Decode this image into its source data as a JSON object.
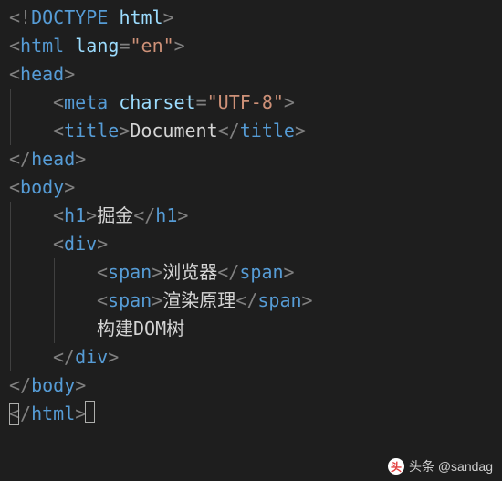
{
  "code": {
    "lines": [
      {
        "indent": 0,
        "guides": [],
        "tokens": [
          {
            "t": "punct",
            "v": "<!"
          },
          {
            "t": "tag",
            "v": "DOCTYPE"
          },
          {
            "t": "text",
            "v": " "
          },
          {
            "t": "attr-name",
            "v": "html"
          },
          {
            "t": "punct",
            "v": ">"
          }
        ]
      },
      {
        "indent": 0,
        "guides": [],
        "tokens": [
          {
            "t": "punct",
            "v": "<"
          },
          {
            "t": "tag",
            "v": "html"
          },
          {
            "t": "text",
            "v": " "
          },
          {
            "t": "attr-name",
            "v": "lang"
          },
          {
            "t": "punct",
            "v": "="
          },
          {
            "t": "attr-value",
            "v": "\"en\""
          },
          {
            "t": "punct",
            "v": ">"
          }
        ]
      },
      {
        "indent": 0,
        "guides": [],
        "tokens": [
          {
            "t": "punct",
            "v": "<"
          },
          {
            "t": "tag",
            "v": "head"
          },
          {
            "t": "punct",
            "v": ">"
          }
        ]
      },
      {
        "indent": 1,
        "guides": [
          0
        ],
        "tokens": [
          {
            "t": "punct",
            "v": "<"
          },
          {
            "t": "tag",
            "v": "meta"
          },
          {
            "t": "text",
            "v": " "
          },
          {
            "t": "attr-name",
            "v": "charset"
          },
          {
            "t": "punct",
            "v": "="
          },
          {
            "t": "attr-value",
            "v": "\"UTF-8\""
          },
          {
            "t": "punct",
            "v": ">"
          }
        ]
      },
      {
        "indent": 1,
        "guides": [
          0
        ],
        "tokens": [
          {
            "t": "punct",
            "v": "<"
          },
          {
            "t": "tag",
            "v": "title"
          },
          {
            "t": "punct",
            "v": ">"
          },
          {
            "t": "text",
            "v": "Document"
          },
          {
            "t": "punct",
            "v": "</"
          },
          {
            "t": "tag",
            "v": "title"
          },
          {
            "t": "punct",
            "v": ">"
          }
        ]
      },
      {
        "indent": 0,
        "guides": [],
        "tokens": [
          {
            "t": "punct",
            "v": "</"
          },
          {
            "t": "tag",
            "v": "head"
          },
          {
            "t": "punct",
            "v": ">"
          }
        ]
      },
      {
        "indent": 0,
        "guides": [],
        "tokens": [
          {
            "t": "punct",
            "v": "<"
          },
          {
            "t": "tag",
            "v": "body"
          },
          {
            "t": "punct",
            "v": ">"
          }
        ]
      },
      {
        "indent": 1,
        "guides": [
          0
        ],
        "tokens": [
          {
            "t": "punct",
            "v": "<"
          },
          {
            "t": "tag",
            "v": "h1"
          },
          {
            "t": "punct",
            "v": ">"
          },
          {
            "t": "text",
            "v": "掘金"
          },
          {
            "t": "punct",
            "v": "</"
          },
          {
            "t": "tag",
            "v": "h1"
          },
          {
            "t": "punct",
            "v": ">"
          }
        ]
      },
      {
        "indent": 1,
        "guides": [
          0
        ],
        "tokens": [
          {
            "t": "punct",
            "v": "<"
          },
          {
            "t": "tag",
            "v": "div"
          },
          {
            "t": "punct",
            "v": ">"
          }
        ]
      },
      {
        "indent": 2,
        "guides": [
          0,
          1
        ],
        "tokens": [
          {
            "t": "punct",
            "v": "<"
          },
          {
            "t": "tag",
            "v": "span"
          },
          {
            "t": "punct",
            "v": ">"
          },
          {
            "t": "text",
            "v": "浏览器"
          },
          {
            "t": "punct",
            "v": "</"
          },
          {
            "t": "tag",
            "v": "span"
          },
          {
            "t": "punct",
            "v": ">"
          }
        ]
      },
      {
        "indent": 2,
        "guides": [
          0,
          1
        ],
        "tokens": [
          {
            "t": "punct",
            "v": "<"
          },
          {
            "t": "tag",
            "v": "span"
          },
          {
            "t": "punct",
            "v": ">"
          },
          {
            "t": "text",
            "v": "渲染原理"
          },
          {
            "t": "punct",
            "v": "</"
          },
          {
            "t": "tag",
            "v": "span"
          },
          {
            "t": "punct",
            "v": ">"
          }
        ]
      },
      {
        "indent": 2,
        "guides": [
          0,
          1
        ],
        "tokens": [
          {
            "t": "text",
            "v": "构建DOM树"
          }
        ]
      },
      {
        "indent": 1,
        "guides": [
          0
        ],
        "tokens": [
          {
            "t": "punct",
            "v": "</"
          },
          {
            "t": "tag",
            "v": "div"
          },
          {
            "t": "punct",
            "v": ">"
          }
        ]
      },
      {
        "indent": 0,
        "guides": [],
        "tokens": [
          {
            "t": "punct",
            "v": "</"
          },
          {
            "t": "tag",
            "v": "body"
          },
          {
            "t": "punct",
            "v": ">"
          }
        ]
      },
      {
        "indent": 0,
        "guides": [],
        "cursor": true,
        "tokens": [
          {
            "t": "punct",
            "v": "</"
          },
          {
            "t": "tag",
            "v": "html"
          },
          {
            "t": "punct",
            "v": ">"
          }
        ]
      }
    ]
  },
  "watermark": {
    "text": "头条 @sandag",
    "logo": "头"
  },
  "layout": {
    "indentWidth": 48,
    "baseLeft": 10
  }
}
